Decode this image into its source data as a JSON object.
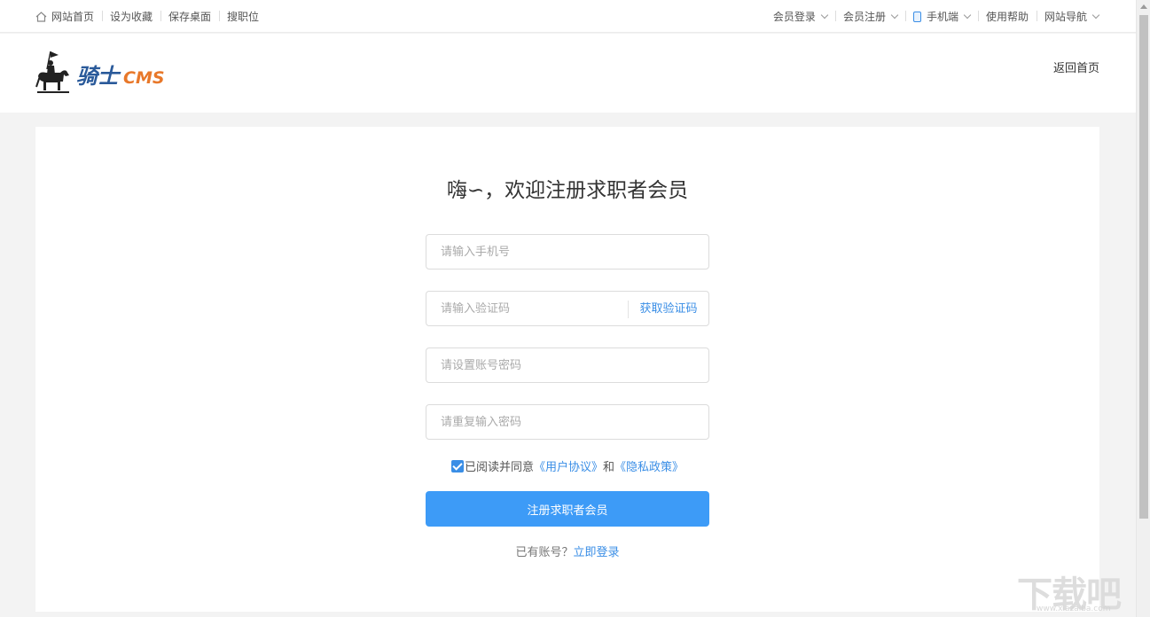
{
  "topbar": {
    "left": [
      "网站首页",
      "设为收藏",
      "保存桌面",
      "搜职位"
    ],
    "right": [
      "会员登录",
      "会员注册",
      "手机端",
      "使用帮助",
      "网站导航"
    ]
  },
  "header": {
    "logo_main": "骑士",
    "logo_sub": "CMS",
    "back_home": "返回首页"
  },
  "form": {
    "title": "嗨∽，欢迎注册求职者会员",
    "phone_placeholder": "请输入手机号",
    "code_placeholder": "请输入验证码",
    "get_code": "获取验证码",
    "password_placeholder": "请设置账号密码",
    "repeat_placeholder": "请重复输入密码",
    "agree_prefix": "已阅读并同意",
    "agreement": "《用户协议》",
    "and": "和",
    "privacy": "《隐私政策》",
    "agree_checked": true,
    "submit": "注册求职者会员",
    "has_account": "已有账号？",
    "login_now": "立即登录"
  },
  "watermark": {
    "text": "下载吧",
    "url": "www.xiazaiba.com"
  },
  "colors": {
    "accent": "#3d9bf7",
    "link": "#3a8ee6",
    "background": "#f3f3f3"
  }
}
